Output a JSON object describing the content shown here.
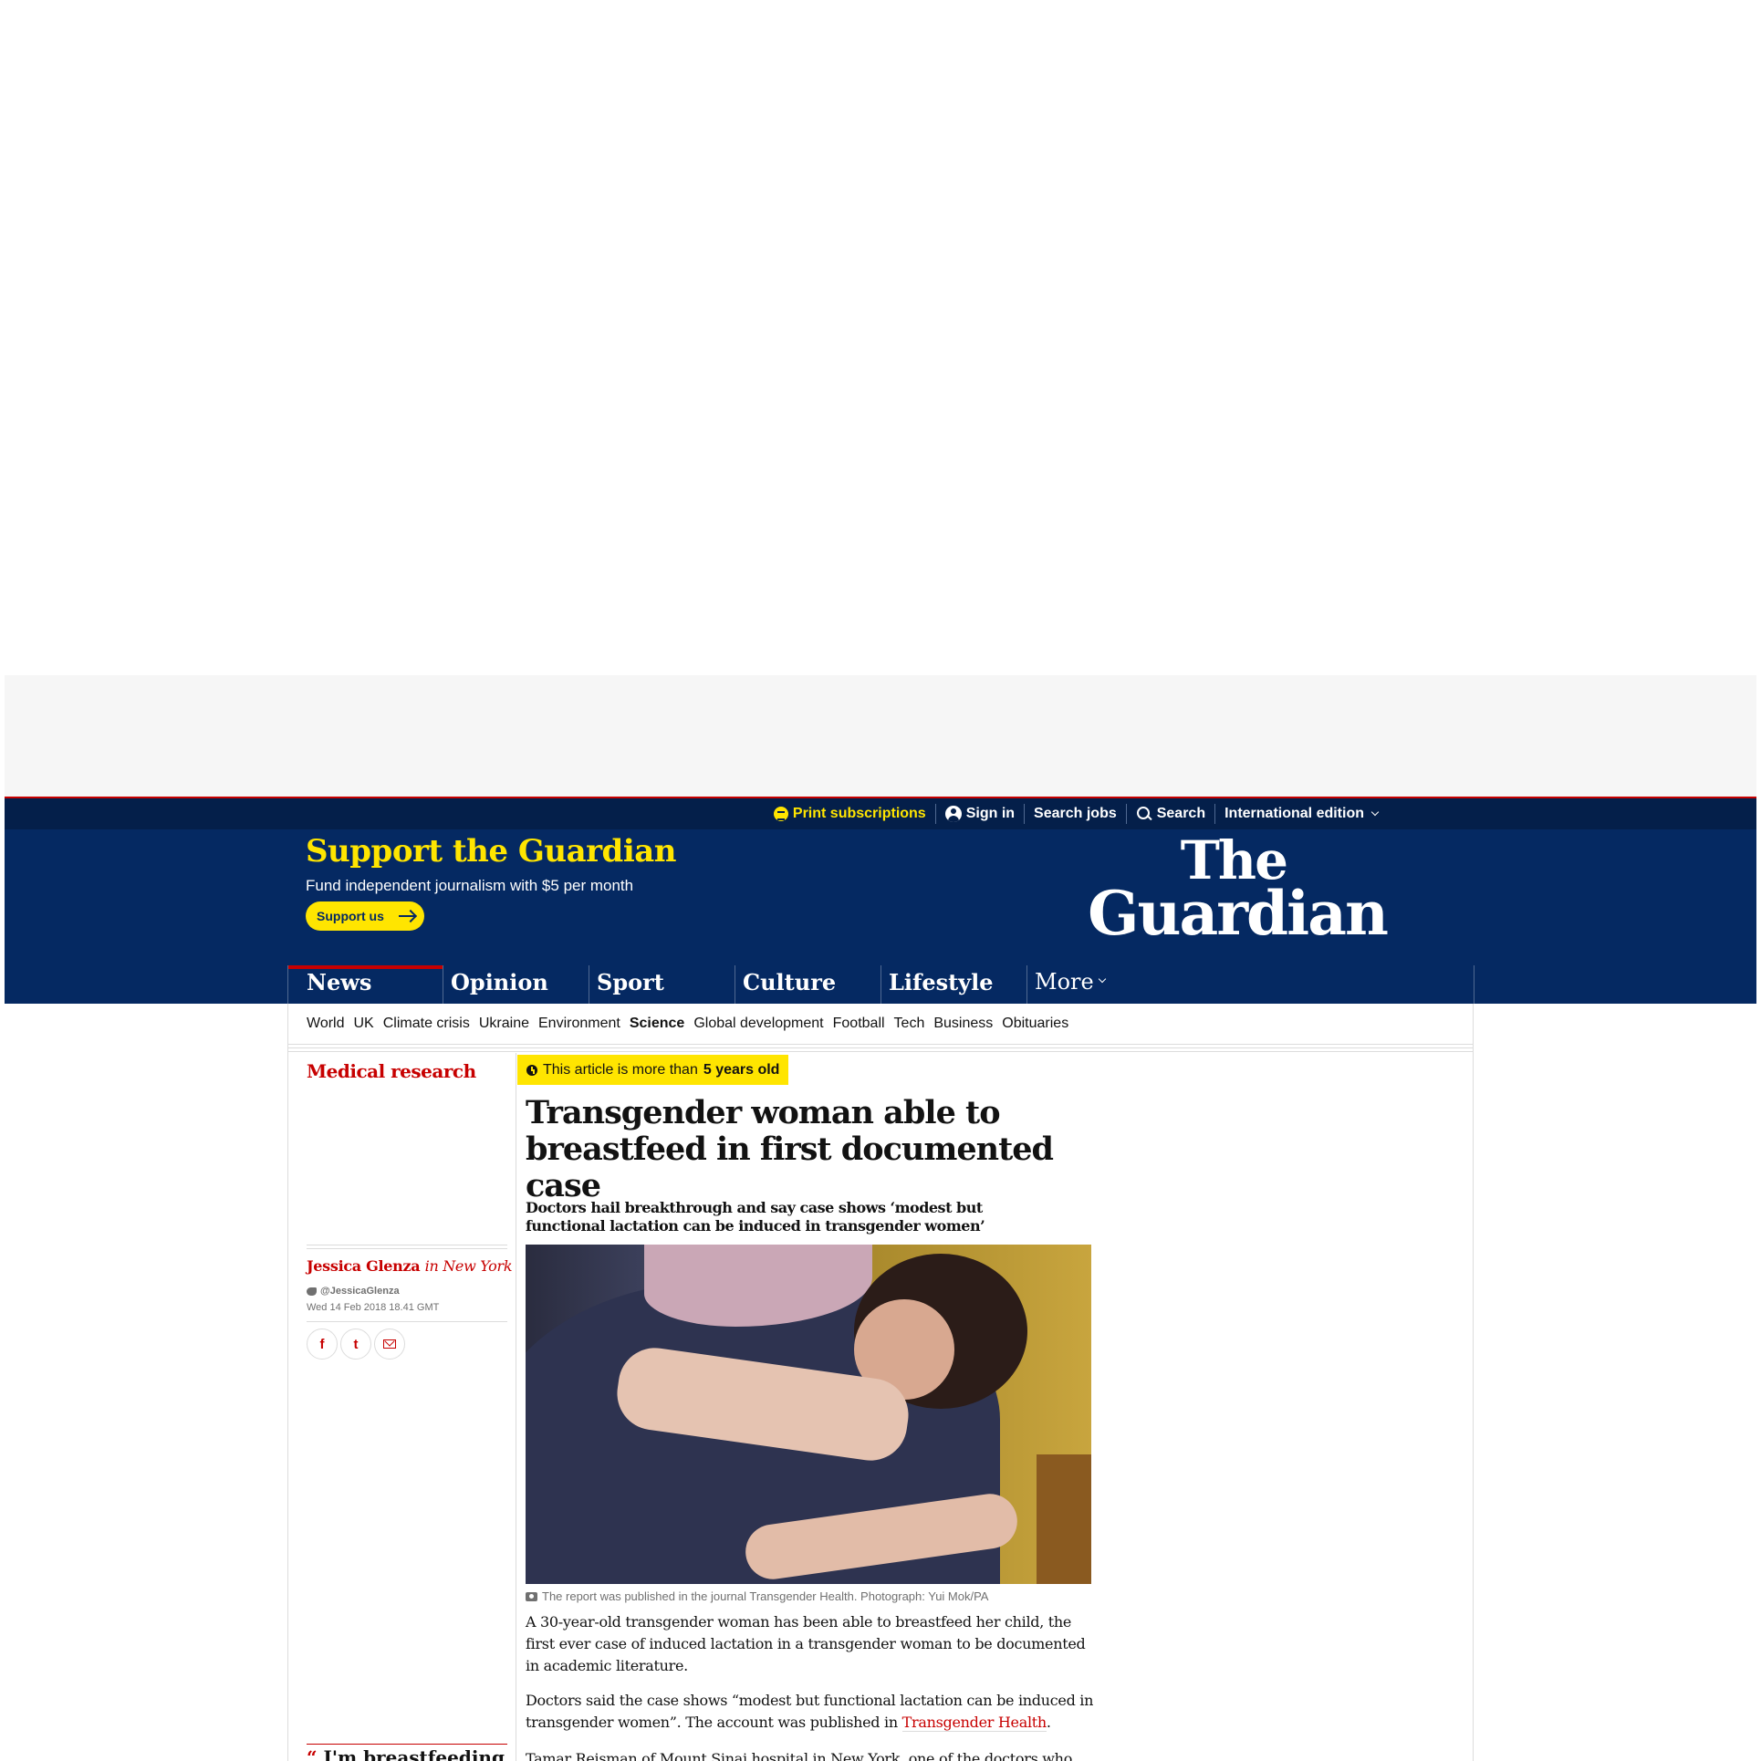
{
  "topbar": {
    "print_subscriptions": "Print subscriptions",
    "sign_in": "Sign in",
    "search_jobs": "Search jobs",
    "search": "Search",
    "edition": "International edition"
  },
  "support": {
    "title": "Support the Guardian",
    "subtitle": "Fund independent journalism with $5 per month",
    "button": "Support us"
  },
  "logo": {
    "line1": "The",
    "line2": "Guardian"
  },
  "pillars": [
    "News",
    "Opinion",
    "Sport",
    "Culture",
    "Lifestyle"
  ],
  "more_label": "More",
  "subnav": [
    "World",
    "UK",
    "Climate crisis",
    "Ukraine",
    "Environment",
    "Science",
    "Global development",
    "Football",
    "Tech",
    "Business",
    "Obituaries"
  ],
  "subnav_active": "Science",
  "article": {
    "section": "Medical research",
    "age_notice_prefix": "This article is more than",
    "age_notice_bold": "5 years old",
    "headline": "Transgender woman able to breastfeed in first documented case",
    "standfirst": "Doctors hail breakthrough and say case shows ‘modest but functional lactation can be induced in transgender women’",
    "author": "Jessica Glenza",
    "author_location": "in New York",
    "twitter_handle": "@JessicaGlenza",
    "date": "Wed 14 Feb 2018 18.41 GMT",
    "share": {
      "facebook": "f",
      "twitter": "t"
    },
    "caption": "The report was published in the journal Transgender Health. Photograph: Yui Mok/PA",
    "paragraph1": "A 30-year-old transgender woman has been able to breastfeed her child, the first ever case of induced lactation in a transgender woman to be documented in academic literature.",
    "paragraph2_before": "Doctors said the case shows “modest but functional lactation can be induced in transgender women”. The account was published in ",
    "paragraph2_link": "Transgender Health",
    "paragraph2_after": ".",
    "paragraph3": "Tamar Reisman of Mount Sinai hospital in New York, one of the doctors who",
    "pullquote": "I'm breastfeeding"
  },
  "colors": {
    "brand_blue": "#052962",
    "topbar_blue": "#041f4a",
    "accent_yellow": "#ffe500",
    "news_red": "#c70000",
    "ad_gray": "#f6f6f6"
  },
  "icons": [
    "coin-icon",
    "person-icon",
    "search-icon",
    "chevron-down-icon",
    "arrow-right-icon",
    "clock-icon",
    "twitter-bird-icon",
    "facebook-icon",
    "twitter-icon",
    "email-icon",
    "camera-icon",
    "quote-mark-icon"
  ]
}
